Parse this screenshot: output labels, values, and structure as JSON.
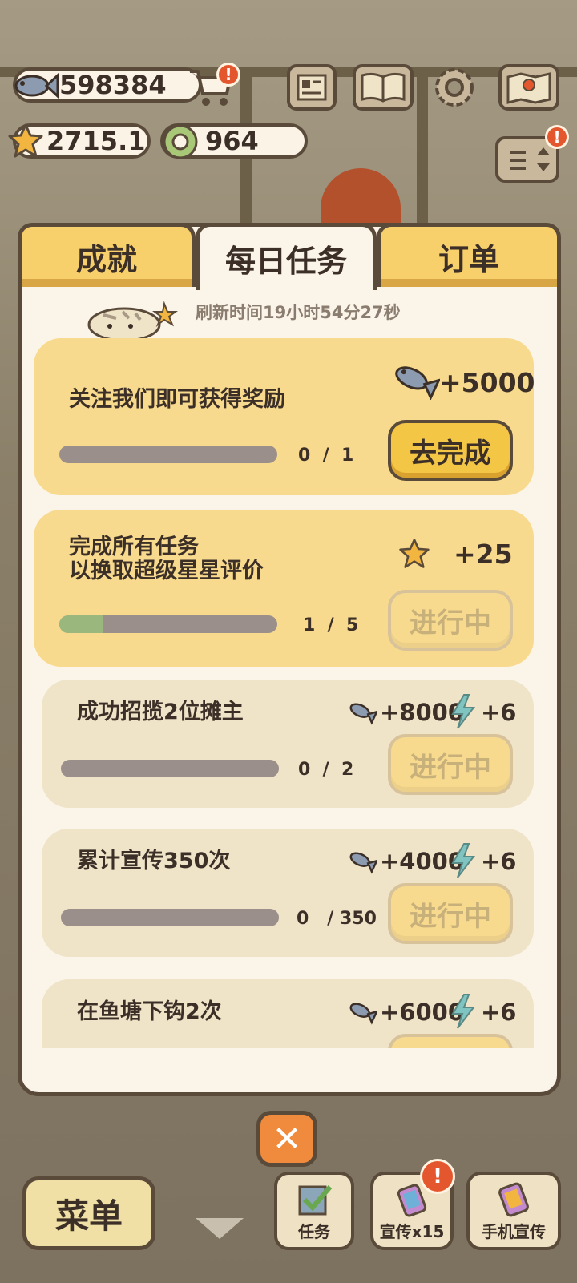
{
  "hud": {
    "fish_count": "598384",
    "star_rating": "2715.1",
    "coin_count": "964",
    "alert_mark": "!"
  },
  "tabs": [
    {
      "label": "成就"
    },
    {
      "label": "每日任务"
    },
    {
      "label": "订单"
    }
  ],
  "refresh_text": "刷新时间19小时54分27秒",
  "tasks": [
    {
      "title": "关注我们即可获得奖励",
      "progress": "0  /  1",
      "progress_fraction": 0,
      "reward_fish": "+5000",
      "button": "去完成"
    },
    {
      "title": "完成所有任务\n以换取超级星星评价",
      "progress": "1  /  5",
      "progress_fraction": 0.2,
      "reward_star": "+25",
      "button": "进行中"
    },
    {
      "title": "成功招揽2位摊主",
      "progress": "0  /  2",
      "progress_fraction": 0,
      "reward_fish": "+8000",
      "reward_energy": "+6",
      "button": "进行中"
    },
    {
      "title": "累计宣传350次",
      "progress": "0   / 350",
      "progress_fraction": 0,
      "reward_fish": "+4000",
      "reward_energy": "+6",
      "button": "进行中"
    },
    {
      "title": "在鱼塘下钩2次",
      "progress": "",
      "progress_fraction": 0,
      "reward_fish": "+6000",
      "reward_energy": "+6",
      "button": ""
    }
  ],
  "bottom": {
    "close": "✕",
    "menu": "菜单",
    "tasks": "任务",
    "promote": "宣传x15",
    "phone_promote": "手机宣传",
    "alert_mark": "!"
  },
  "colors": {
    "panel_bg": "#fbf4e8",
    "tab_yellow": "#f8d06b",
    "card_highlight": "#f8da8e",
    "card_dim": "#efe3c8",
    "button_go": "#f4c645",
    "close_orange": "#f08a3c",
    "progress_green": "#9ab87e"
  }
}
